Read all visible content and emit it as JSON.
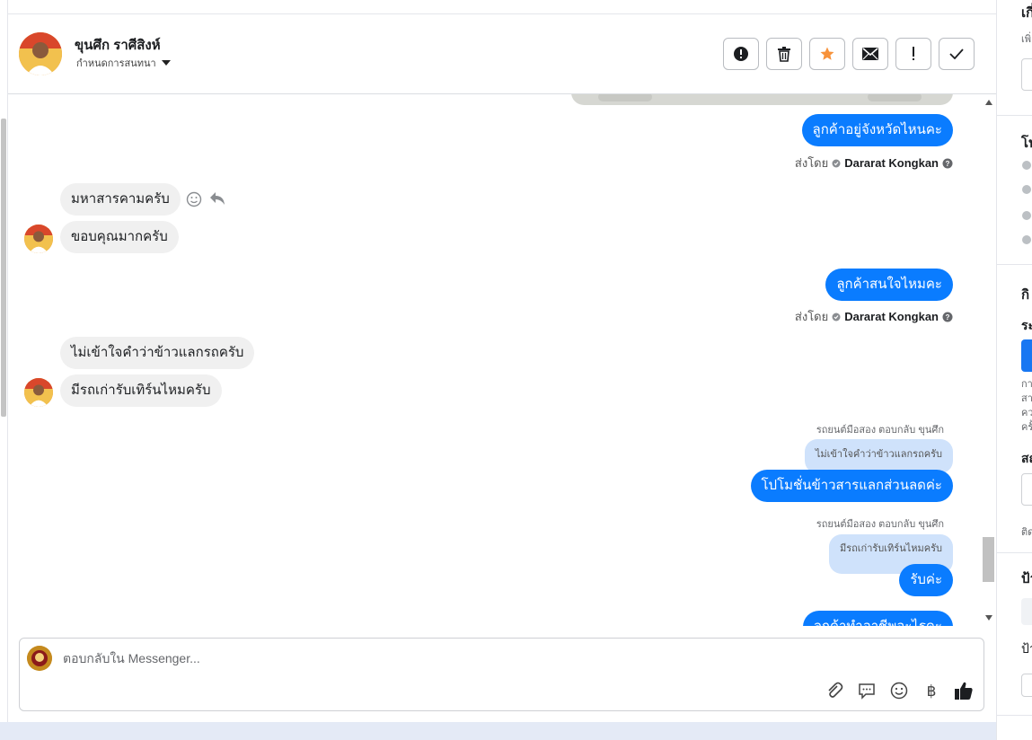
{
  "header": {
    "contact_name": "ขุนศึก ราศีสิงห์",
    "assign_label": "กำหนดการสนทนา",
    "actions": [
      {
        "name": "mark-spam-button",
        "icon": "alert-circle-icon"
      },
      {
        "name": "delete-button",
        "icon": "trash-icon"
      },
      {
        "name": "star-button",
        "icon": "star-icon"
      },
      {
        "name": "mark-unread-button",
        "icon": "envelope-icon"
      },
      {
        "name": "follow-up-button",
        "icon": "exclamation-icon"
      },
      {
        "name": "mark-done-button",
        "icon": "check-icon"
      }
    ],
    "star_color": "#f7923a"
  },
  "messages": {
    "out1": "ลูกค้าอยู่จังหวัดไหนคะ",
    "sent_by_label": "ส่งโดย",
    "sender_name": "Dararat Kongkan",
    "in1": "มหาสารคามครับ",
    "in2": "ขอบคุณมากครับ",
    "out2": "ลูกค้าสนใจไหมคะ",
    "in3": "ไม่เข้าใจคำว่าข้าวแลกรถครับ",
    "in4": "มีรถเก่ารับเทิร์นไหมครับ",
    "reply1_note": "รถยนต์มือสอง ตอบกลับ ขุนศึก",
    "reply1_quote": "ไม่เข้าใจคำว่าข้าวแลกรถครับ",
    "out3": "โปโมชั่นข้าวสารแลกส่วนลดค่ะ",
    "reply2_note": "รถยนต์มือสอง ตอบกลับ ขุนศึก",
    "reply2_quote": "มีรถเก่ารับเทิร์นไหมครับ",
    "out4": "รับค่ะ",
    "out5_partial": "ลูกค้าทำอาชีพอะไรคะ"
  },
  "composer": {
    "placeholder": "ตอบกลับใน Messenger...",
    "tools": [
      "paperclip-icon",
      "saved-reply-icon",
      "emoji-icon",
      "baht-icon",
      "like-icon"
    ]
  },
  "side_panel": {
    "texts": [
      "เกี่",
      "เพิ่",
      "โป",
      "กิ",
      "ระ",
      "กา",
      "สา",
      "คว",
      "ครั้",
      "สถ",
      "ติด",
      "ป้า",
      "ป้า"
    ]
  },
  "colors": {
    "accent": "#0a7cff",
    "incoming_bubble": "#f0f0f0",
    "quote_bubble": "#cfe2fb"
  }
}
